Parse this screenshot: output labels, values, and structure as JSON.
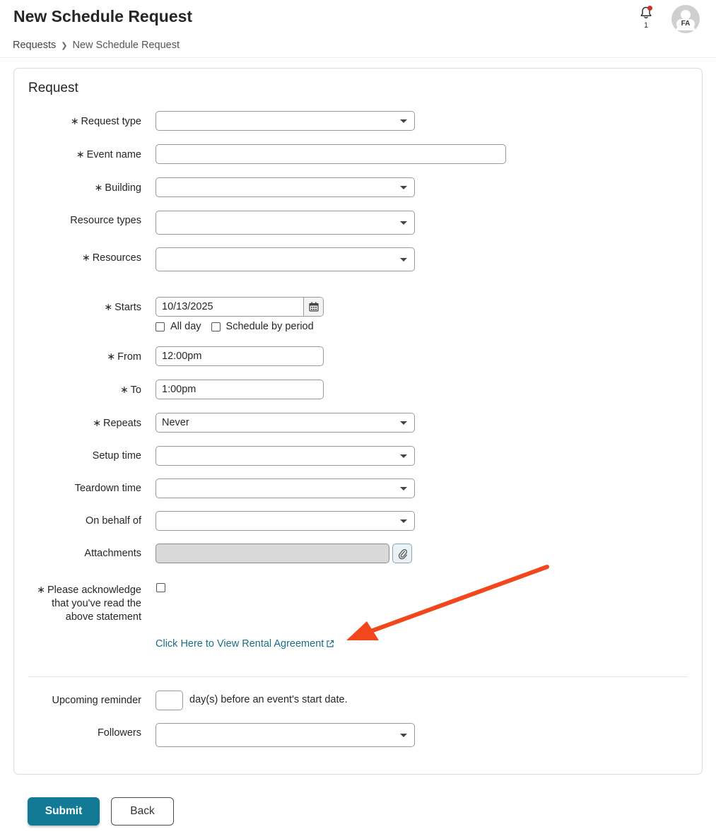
{
  "header": {
    "title": "New Schedule Request",
    "breadcrumb": {
      "parent": "Requests",
      "separator_icon": "chevron-right-icon",
      "current": "New Schedule Request"
    },
    "notifications": {
      "icon": "bell-icon",
      "count": "1",
      "badge_color": "#d0312d"
    },
    "user": {
      "initials": "FA",
      "icon": "user-avatar-icon"
    }
  },
  "form": {
    "section_title": "Request",
    "required_marker": "∗",
    "fields": {
      "request_type": {
        "label": "Request type",
        "required": true,
        "value": ""
      },
      "event_name": {
        "label": "Event name",
        "required": true,
        "value": ""
      },
      "building": {
        "label": "Building",
        "required": true,
        "value": ""
      },
      "resource_types": {
        "label": "Resource types",
        "required": false,
        "value": ""
      },
      "resources": {
        "label": "Resources",
        "required": true,
        "value": ""
      },
      "starts": {
        "label": "Starts",
        "required": true,
        "value": "10/13/2025",
        "icon": "calendar-icon"
      },
      "all_day": {
        "label": "All day",
        "checked": false
      },
      "schedule_by_period": {
        "label": "Schedule by period",
        "checked": false
      },
      "from": {
        "label": "From",
        "required": true,
        "value": "12:00pm"
      },
      "to": {
        "label": "To",
        "required": true,
        "value": "1:00pm"
      },
      "repeats": {
        "label": "Repeats",
        "required": true,
        "value": "Never"
      },
      "setup_time": {
        "label": "Setup time",
        "required": false,
        "value": ""
      },
      "teardown_time": {
        "label": "Teardown time",
        "required": false,
        "value": ""
      },
      "on_behalf_of": {
        "label": "On behalf of",
        "required": false,
        "value": ""
      },
      "attachments": {
        "label": "Attachments",
        "icon": "paperclip-icon"
      },
      "acknowledge": {
        "label_line1": "Please acknowledge",
        "label_line2": "that you've read the",
        "label_line3": "above statement",
        "required": true,
        "checked": false
      },
      "rental_agreement_link": {
        "text": "Click Here to View Rental Agreement",
        "icon": "external-link-icon"
      },
      "upcoming_reminder": {
        "label": "Upcoming reminder",
        "value": "",
        "suffix": "day(s) before an event's start date."
      },
      "followers": {
        "label": "Followers",
        "required": false,
        "value": ""
      }
    }
  },
  "annotation": {
    "type": "arrow",
    "color": "#f2471c",
    "target": "rental_agreement_link"
  },
  "actions": {
    "submit": "Submit",
    "back": "Back"
  },
  "colors": {
    "primary": "#137a96",
    "link": "#1a6e85",
    "text": "#262626"
  }
}
